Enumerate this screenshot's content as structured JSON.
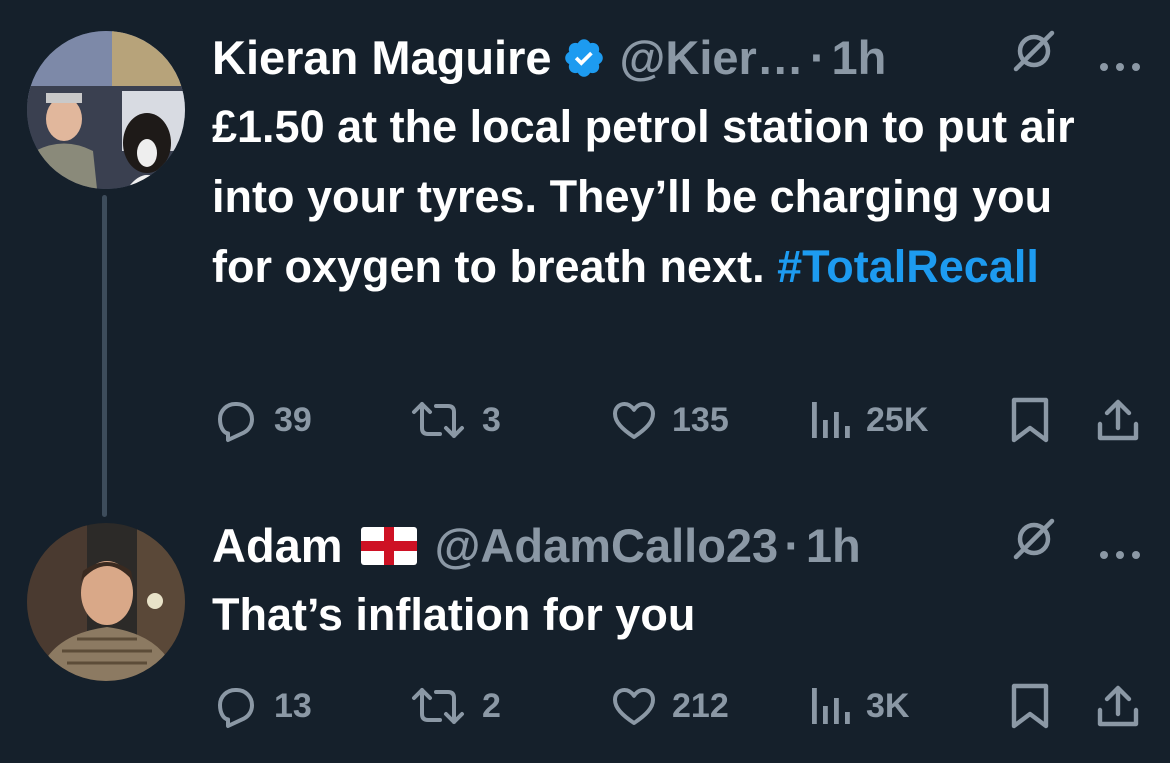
{
  "tweets": [
    {
      "author_name": "Kieran Maguire",
      "verified": true,
      "handle": "@Kier…",
      "separator": "·",
      "time": "1h",
      "text_main": "£1.50 at the local petrol station to put air into your tyres. They’ll be charging you for oxygen to breath next.",
      "hashtag": "#TotalRecall",
      "replies": "39",
      "retweets": "3",
      "likes": "135",
      "views": "25K",
      "avatar_icon": "profile-photo-man-with-dog"
    },
    {
      "author_name": "Adam",
      "flag_icon": "england-flag-icon",
      "handle": "@AdamCallo23",
      "separator": "·",
      "time": "1h",
      "text_main": "That’s inflation for you",
      "replies": "13",
      "retweets": "2",
      "likes": "212",
      "views": "3K",
      "avatar_icon": "profile-photo-man"
    }
  ],
  "colors": {
    "background": "#15202b",
    "text": "#ffffff",
    "muted": "#8b98a5",
    "accent": "#1d9bf0",
    "thread_line": "#3d4c5b"
  }
}
